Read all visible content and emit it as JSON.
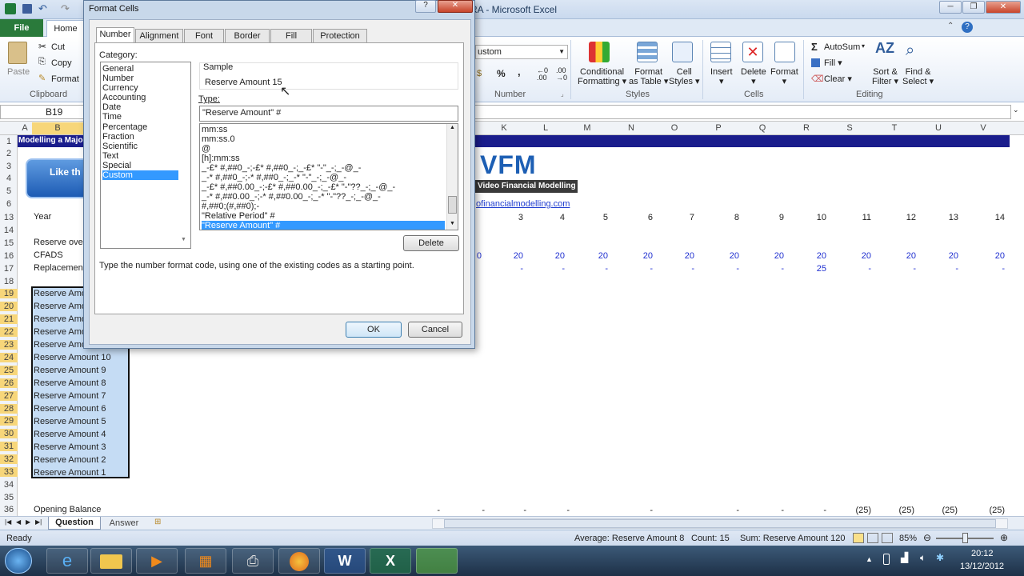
{
  "window": {
    "title": "MRA  -  Microsoft Excel"
  },
  "ribbon": {
    "tabs": {
      "file": "File",
      "home": "Home"
    },
    "clipboard": {
      "paste": "Paste",
      "cut": "Cut",
      "copy": "Copy",
      "format_painter": "Format",
      "group": "Clipboard"
    },
    "number": {
      "format_value": "ustom",
      "percent": "%",
      "comma": ",",
      "group": "Number"
    },
    "styles": {
      "conditional": "Conditional",
      "conditional2": "Formatting",
      "format_as": "Format",
      "format_as2": "as Table",
      "cell": "Cell",
      "cell2": "Styles",
      "group": "Styles"
    },
    "cells": {
      "insert": "Insert",
      "delete": "Delete",
      "format": "Format",
      "group": "Cells"
    },
    "editing": {
      "autosum": "AutoSum",
      "fill": "Fill",
      "clear": "Clear",
      "sort": "Sort &",
      "sort2": "Filter",
      "find": "Find &",
      "find2": "Select",
      "group": "Editing"
    }
  },
  "formula_bar": {
    "name_box": "B19"
  },
  "grid": {
    "columns": [
      "A",
      "B",
      "K",
      "L",
      "M",
      "N",
      "O",
      "P",
      "Q",
      "R",
      "S",
      "T",
      "U",
      "V"
    ],
    "rows": [
      "1",
      "2",
      "3",
      "4",
      "5",
      "6",
      "13",
      "14",
      "15",
      "16",
      "17",
      "18",
      "19",
      "20",
      "21",
      "22",
      "23",
      "24",
      "25",
      "26",
      "27",
      "28",
      "29",
      "30",
      "31",
      "32",
      "33",
      "34",
      "35",
      "36"
    ],
    "banner": "Modelling a Majo",
    "like_button": "Like th",
    "logo_text": "VFM",
    "logo_sub": "Video Financial Modelling",
    "link": "ofinancialmodelling.com",
    "labels": {
      "year": "Year",
      "reserve_over": "Reserve ove",
      "cfads": "CFADS",
      "replacement": "Replacemen",
      "opening_balance": "Opening Balance"
    },
    "year_values": [
      "3",
      "4",
      "5",
      "6",
      "7",
      "8",
      "9",
      "10",
      "11",
      "12",
      "13",
      "14"
    ],
    "cfads_values": [
      "20",
      "20",
      "20",
      "20",
      "20",
      "20",
      "20",
      "20",
      "20",
      "20",
      "20",
      "20"
    ],
    "cfads_partial": "0",
    "replacement_values": [
      "-",
      "-",
      "-",
      "-",
      "-",
      "-",
      "-",
      "25",
      "-",
      "-",
      "-",
      "-"
    ],
    "opening_values": [
      "-",
      "-",
      "-",
      "-",
      "-",
      "-",
      "-",
      "-",
      "(25)",
      "(25)",
      "(25)",
      "(25)"
    ],
    "reserve_list": [
      "Reserve Amo",
      "Reserve Amo",
      "Reserve Amo",
      "Reserve Amo",
      "Reserve Amo",
      "Reserve Amount 10",
      "Reserve Amount 9",
      "Reserve Amount 8",
      "Reserve Amount 7",
      "Reserve Amount 6",
      "Reserve Amount 5",
      "Reserve Amount 4",
      "Reserve Amount 3",
      "Reserve Amount 2",
      "Reserve Amount 1"
    ]
  },
  "sheet_tabs": [
    "Question",
    "Answer"
  ],
  "status": {
    "ready": "Ready",
    "average": "Average: Reserve Amount 8",
    "count": "Count: 15",
    "sum": "Sum: Reserve Amount 120",
    "zoom": "85%"
  },
  "taskbar": {
    "time": "20:12",
    "date": "13/12/2012"
  },
  "dialog": {
    "title": "Format Cells",
    "tabs": [
      "Number",
      "Alignment",
      "Font",
      "Border",
      "Fill",
      "Protection"
    ],
    "category_label": "Category:",
    "categories": [
      "General",
      "Number",
      "Currency",
      "Accounting",
      "Date",
      "Time",
      "Percentage",
      "Fraction",
      "Scientific",
      "Text",
      "Special",
      "Custom"
    ],
    "selected_category": "Custom",
    "sample_label": "Sample",
    "sample_value": "Reserve Amount 15",
    "type_label": "Type:",
    "type_value": "\"Reserve Amount\" #",
    "type_list": [
      "mm:ss",
      "mm:ss.0",
      "@",
      "[h]:mm:ss",
      "_-£* #,##0_-;-£* #,##0_-;_-£* \"-\"_-;_-@_-",
      "_-* #,##0_-;-* #,##0_-;_-* \"-\"_-;_-@_-",
      "_-£* #,##0.00_-;-£* #,##0.00_-;_-£* \"-\"??_-;_-@_-",
      "_-* #,##0.00_-;-* #,##0.00_-;_-* \"-\"??_-;_-@_-",
      "#,##0;(#,##0);-",
      "\"Relative Period\" #",
      "\"Reserve Amount\" #"
    ],
    "delete": "Delete",
    "hint": "Type the number format code, using one of the existing codes as a starting point.",
    "ok": "OK",
    "cancel": "Cancel"
  }
}
